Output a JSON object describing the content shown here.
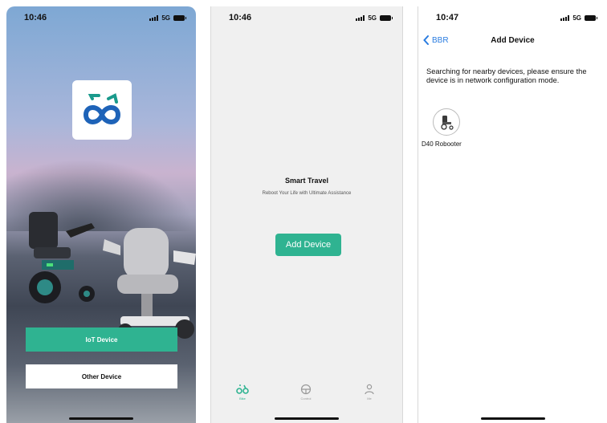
{
  "screen1": {
    "time": "10:46",
    "network": "5G",
    "iot_button": "IoT Device",
    "other_button": "Other Device"
  },
  "screen2": {
    "time": "10:46",
    "network": "5G",
    "title": "Smart Travel",
    "subtitle": "Reboot Your Life with Ultimate Assistance",
    "add_button": "Add Device",
    "tabs": [
      {
        "label": "Bike",
        "icon": "bike-icon",
        "active": true
      },
      {
        "label": "Control",
        "icon": "steering-wheel-icon",
        "active": false
      },
      {
        "label": "Me",
        "icon": "person-icon",
        "active": false
      }
    ]
  },
  "screen3": {
    "time": "10:47",
    "network": "5G",
    "back_label": "BBR",
    "title": "Add Device",
    "hint": "Searching for nearby devices, please ensure the device is in network configuration mode.",
    "devices": [
      {
        "name": "D40 Robooter",
        "icon": "wheelchair-icon"
      }
    ]
  },
  "colors": {
    "accent": "#2fb391",
    "link": "#2a7ce0"
  }
}
